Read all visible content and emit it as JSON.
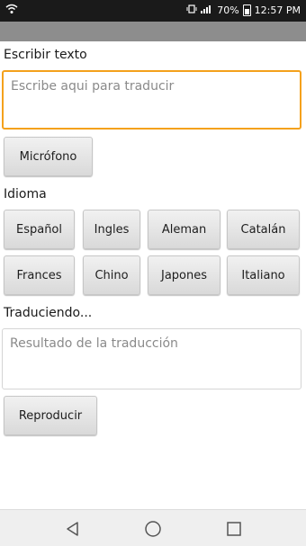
{
  "status_bar": {
    "battery": "70%",
    "time": "12:57 PM"
  },
  "input_section": {
    "label": "Escribir texto",
    "placeholder": "Escribe aqui para traducir"
  },
  "mic_button": "Micrófono",
  "language_section": {
    "label": "Idioma",
    "languages": [
      "Español",
      "Ingles",
      "Aleman",
      "Catalán",
      "Frances",
      "Chino",
      "Japones",
      "Italiano"
    ]
  },
  "result_section": {
    "label": "Traduciendo...",
    "placeholder": "Resultado de la traducción"
  },
  "play_button": "Reproducir",
  "colors": {
    "focus_border": "#f4a11c",
    "action_bar": "#8d8d8d"
  },
  "nav_icons": [
    "back-icon",
    "home-icon",
    "recents-icon"
  ]
}
